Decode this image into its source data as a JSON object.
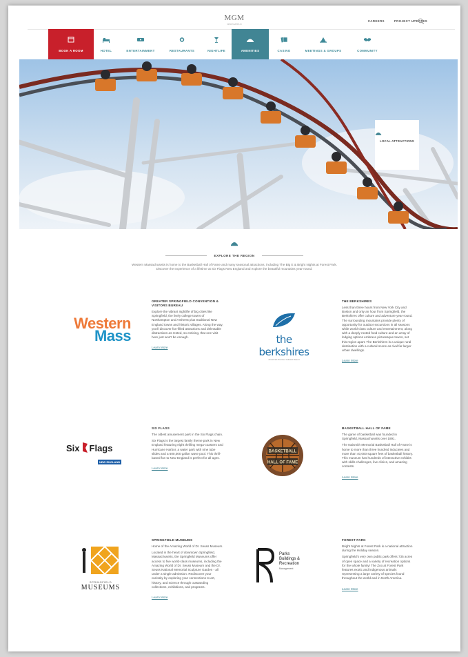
{
  "header": {
    "logo": "MGM",
    "logo_sub": "SPRINGFIELD",
    "links": [
      "CAREERS",
      "PROJECT UPDATES"
    ]
  },
  "nav": {
    "items": [
      {
        "label": "BOOK A ROOM",
        "icon": "calendar-icon",
        "state": "highlight"
      },
      {
        "label": "HOTEL",
        "icon": "bed-icon",
        "state": "normal"
      },
      {
        "label": "ENTERTAINMENT",
        "icon": "ticket-icon",
        "state": "normal"
      },
      {
        "label": "RESTAURANTS",
        "icon": "dining-icon",
        "state": "normal"
      },
      {
        "label": "NIGHTLIFE",
        "icon": "cocktail-icon",
        "state": "normal"
      },
      {
        "label": "AMENITIES",
        "icon": "amenities-icon",
        "state": "active"
      },
      {
        "label": "CASINO",
        "icon": "cards-icon",
        "state": "normal"
      },
      {
        "label": "MEETINGS & GROUPS",
        "icon": "meetings-icon",
        "state": "normal"
      },
      {
        "label": "COMMUNITY",
        "icon": "handshake-icon",
        "state": "normal"
      }
    ]
  },
  "hero": {
    "card_label": "LOCAL ATTRACTIONS"
  },
  "intro": {
    "title": "EXPLORE THE REGION",
    "text": "Western Massachusetts is home to the Basketball Hall of Fame and many seasonal attractions, including The Big E & Bright Nights at Forest Park. Discover the experience of a lifetime at Six Flags New England and explore the beautiful mountains year-round."
  },
  "colors": {
    "brand_red": "#c8202b",
    "teal": "#418594",
    "western_orange": "#ee7a39",
    "mass_blue": "#1f93c7"
  },
  "listings": [
    {
      "title": "GREATER SPRINGFIELD CONVENTION & VISITORS BUREAU",
      "logo_text": [
        "Western",
        "Mass"
      ],
      "paragraphs": [
        "Explore the vibrant nightlife of big cities like Springfield, the lively college towns of Northampton and Amherst plus traditional New England towns and historic villages. Along the way, you'll discover fun-filled attractions and delectable distractions as rested, so enticing, that one visit here just won't be enough."
      ],
      "link": "Learn More"
    },
    {
      "title": "THE BERKSHIRES",
      "logo_text": [
        "the berkshires",
        "America's Premier Cultural Resort"
      ],
      "paragraphs": [
        "Less than three hours from New York City and Boston and only an hour from Springfield, the Berkshires offer culture and adventure year-round. The surrounding mountains provide plenty of opportunity for outdoor excursions in all seasons while world-class culture and entertainment, along with a deeply rooted food culture and an array of lodging options embrace picturesque towns, set this region apart. The Berkshires is a unique rural destination with a cultural scene as rival far larger urban dwellings."
      ],
      "link": "Learn More"
    },
    {
      "title": "SIX FLAGS",
      "logo_text": [
        "Six",
        "Flags",
        "NEW ENGLAND"
      ],
      "paragraphs": [
        "The oldest amusement park in the Six Flags chain.",
        "Six Flags is the largest family theme park in New England featuring eight thrilling mega-coasters and Hurricane Harbor, a water park with nine tube slides and a 600,000 gallon wave pool. This thrill-based fun to New England is perfect for all ages."
      ],
      "link": "Learn More"
    },
    {
      "title": "BASKETBALL HALL OF FAME",
      "logo_text": [
        "BASKETBALL",
        "HALL OF FAME"
      ],
      "paragraphs": [
        "The game of basketball was founded in Springfield, Massachusetts over 1891.",
        "The Naismith Memorial Basketball Hall of Fame is home to more than three hundred inductees and more than 40,000 square feet of basketball history. This museum has hundreds of interactive exhibits with skills challenges, live clinics, and amazing contests."
      ],
      "link": "Learn More"
    },
    {
      "title": "SPRINGFIELD MUSEUMS",
      "logo_text": [
        "SPRINGFIELD",
        "MUSEUMS"
      ],
      "paragraphs": [
        "Home of the Amazing World of Dr. Seuss Museum.",
        "Located in the heart of downtown Springfield, Massachusetts, the Springfield Museums offer access to five world-class museums, including the Amazing World of Dr. Seuss Museum and the Dr. Seuss National Memorial Sculpture Garden - all under a single admission. Rediscover your curiosity by exploring your connections to art, history, and science through outstanding collections, exhibitions, and programs."
      ],
      "link": "Learn More"
    },
    {
      "title": "FOREST PARK",
      "logo_text": [
        "Parks",
        "Buildings &",
        "Recreation",
        "Management"
      ],
      "paragraphs": [
        "Bright Nights at Forest Park is a national attraction during the Holiday season.",
        "Springfield's very own public park offers 735 acres of open space and a variety of recreation options for the whole family! The Zoo at Forest Park features exotic and indigenous animals representing a large variety of species found throughout the world and in North America."
      ],
      "link": "Learn More"
    }
  ]
}
